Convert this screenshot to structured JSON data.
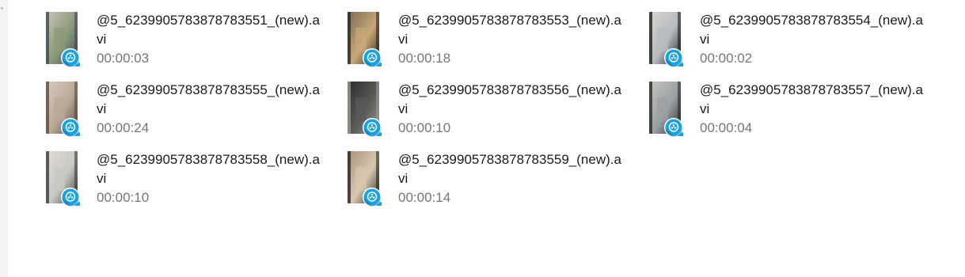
{
  "files": [
    {
      "name": "@5_6239905783878783551_(new).avi",
      "duration": "00:00:03",
      "thumb_colors": [
        "#8a9a7a",
        "#3f4a55",
        "#c9c4b8"
      ],
      "icon": "video-file-icon"
    },
    {
      "name": "@5_6239905783878783553_(new).avi",
      "duration": "00:00:18",
      "thumb_colors": [
        "#c8a878",
        "#2b2520",
        "#7a6a55"
      ],
      "icon": "video-file-icon"
    },
    {
      "name": "@5_6239905783878783554_(new).avi",
      "duration": "00:00:02",
      "thumb_colors": [
        "#b8bcc0",
        "#1c1c1c",
        "#d8d4cc"
      ],
      "icon": "video-file-icon"
    },
    {
      "name": "@5_6239905783878783555_(new).avi",
      "duration": "00:00:24",
      "thumb_colors": [
        "#b8a898",
        "#5a4a40",
        "#d8ccc0"
      ],
      "icon": "video-file-icon"
    },
    {
      "name": "@5_6239905783878783556_(new).avi",
      "duration": "00:00:10",
      "thumb_colors": [
        "#5a5a58",
        "#9a9890",
        "#2c2a28"
      ],
      "icon": "video-file-icon"
    },
    {
      "name": "@5_6239905783878783557_(new).avi",
      "duration": "00:00:04",
      "thumb_colors": [
        "#9aa0a4",
        "#2a2826",
        "#c8c4bc"
      ],
      "icon": "video-file-icon"
    },
    {
      "name": "@5_6239905783878783558_(new).avi",
      "duration": "00:00:10",
      "thumb_colors": [
        "#c8c8c4",
        "#3a3a38",
        "#e0dcd4"
      ],
      "icon": "video-file-icon"
    },
    {
      "name": "@5_6239905783878783559_(new).avi",
      "duration": "00:00:14",
      "thumb_colors": [
        "#d8c8b0",
        "#2a2420",
        "#a89078"
      ],
      "icon": "video-file-icon"
    }
  ],
  "colors": {
    "badge_blue": "#1aa3e0",
    "badge_dark": "#0b6fa8",
    "name_text": "#1a1a1a",
    "duration_text": "#767676"
  }
}
